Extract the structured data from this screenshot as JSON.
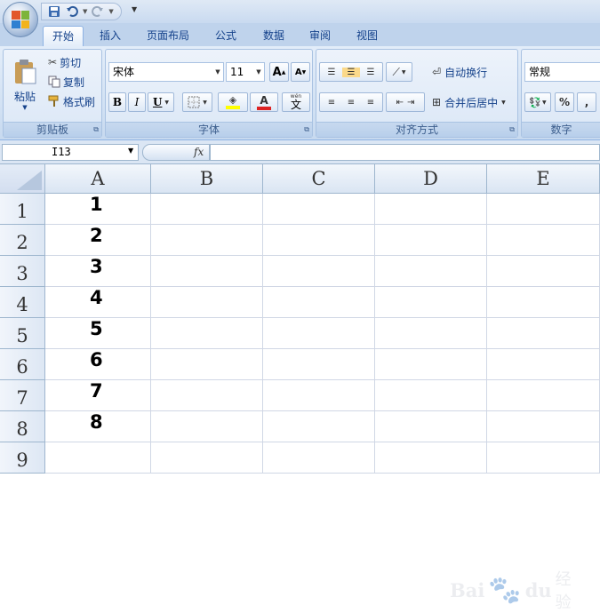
{
  "quick_access": {
    "save_icon": "save-icon",
    "undo_icon": "undo-icon",
    "redo_icon": "redo-icon",
    "customize_icon": "customize-qat-icon"
  },
  "tabs": [
    {
      "label": "开始",
      "active": true
    },
    {
      "label": "插入"
    },
    {
      "label": "页面布局"
    },
    {
      "label": "公式"
    },
    {
      "label": "数据"
    },
    {
      "label": "审阅"
    },
    {
      "label": "视图"
    }
  ],
  "ribbon": {
    "clipboard": {
      "paste_label": "粘贴",
      "cut_label": "剪切",
      "copy_label": "复制",
      "format_painter_label": "格式刷",
      "group_label": "剪贴板"
    },
    "font": {
      "font_name": "宋体",
      "font_size": "11",
      "grow_label": "A",
      "shrink_label": "A",
      "bold_label": "B",
      "italic_label": "I",
      "underline_label": "U",
      "font_color_label": "A",
      "phonetic_label": "文",
      "phonetic_top": "wén",
      "group_label": "字体",
      "font_color": "#d22",
      "highlight_color": "#ff0"
    },
    "alignment": {
      "wrap_text_label": "自动换行",
      "merge_center_label": "合并后居中",
      "group_label": "对齐方式"
    },
    "number": {
      "format": "常规",
      "percent_label": "%",
      "comma_label": ",",
      "group_label": "数字"
    }
  },
  "formula_bar": {
    "name_box": "I13",
    "fx_label": "fx",
    "formula": ""
  },
  "sheet": {
    "columns": [
      "A",
      "B",
      "C",
      "D",
      "E"
    ],
    "rows": [
      "1",
      "2",
      "3",
      "4",
      "5",
      "6",
      "7",
      "8",
      "9"
    ],
    "column_a_values": [
      "1",
      "2",
      "3",
      "4",
      "5",
      "6",
      "7",
      "8",
      ""
    ]
  },
  "watermark": {
    "text": "Bai",
    "paw_icon": "baidu-paw-icon",
    "du_text": "du",
    "sub_text": "经验"
  }
}
